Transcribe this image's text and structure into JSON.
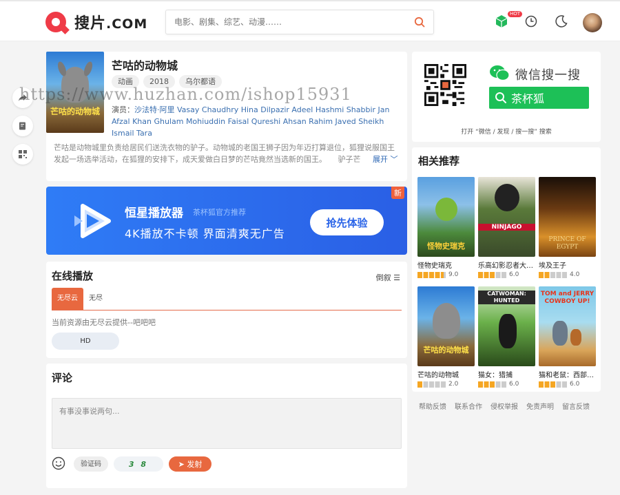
{
  "header": {
    "logo_text": "搜片",
    "logo_suffix": ".COM",
    "search_placeholder": "电影、剧集、综艺、动漫……",
    "hot_badge": "HOT",
    "icons": [
      "cube-icon",
      "history-icon",
      "moon-icon",
      "avatar"
    ]
  },
  "side_tools": [
    "share-icon",
    "edit-icon",
    "qrcode-icon"
  ],
  "movie": {
    "title": "芒咕的动物城",
    "tags": [
      "动画",
      "2018",
      "乌尔都语"
    ],
    "actors_label": "演员：",
    "actors_text": "沙法特·阿里 Vasay Chaudhry Hina Dilpazir Adeel Hashmi Shabbir Jan Afzal Khan Ghulam Mohiuddin Faisal Qureshi Ahsan Rahim Javed Sheikh Ismail Tara",
    "description": "芒咕是动物城里负责给居民们送洗衣物的驴子。动物城的老国王狮子因为年迈打算退位，狐狸说服国王发起一场选举活动，在狐狸的安排下，成天爱做白日梦的芒咕竟然当选新的国王。　　驴子芒",
    "expand_label": "展开",
    "poster_caption": "芒咕的动物城"
  },
  "watermark": "https://www.huzhan.com/ishop15931",
  "banner": {
    "title": "恒星播放器",
    "subtitle": "茶杯狐官方推荐",
    "slogan": "4K播放不卡顿  界面清爽无广告",
    "button": "抢先体验",
    "badge": "新",
    "colors": {
      "bg_start": "#2f7cf6",
      "bg_end": "#2a5fe5"
    }
  },
  "online": {
    "title": "在线播放",
    "sort_label": "倒叙",
    "sources": [
      "无尽云",
      "无尽"
    ],
    "active_source": "无尽云",
    "note": "当前资源由无尽云提供--吧吧吧",
    "episodes": [
      "HD"
    ]
  },
  "comment": {
    "title": "评论",
    "placeholder": "有事没事说两句...",
    "captcha_placeholder": "验证码",
    "captcha_image_text": "3 8",
    "send_label": "发射"
  },
  "qr": {
    "title": "微信搜一搜",
    "search_text": "茶杯狐",
    "note": "打开 “微信 / 发现 / 搜一搜” 搜索"
  },
  "recommendations": {
    "title": "相关推荐",
    "items": [
      {
        "name": "怪物史瑞克",
        "rating": "9.0",
        "score": 9.0,
        "poster_text": "怪物史瑞克"
      },
      {
        "name": "乐高幻影忍者大电影",
        "rating": "6.0",
        "score": 6.0,
        "poster_text": "NINJAGO"
      },
      {
        "name": "埃及王子",
        "rating": "4.0",
        "score": 4.0,
        "poster_text": "PRINCE OF EGYPT"
      },
      {
        "name": "芒咕的动物城",
        "rating": "2.0",
        "score": 2.0,
        "poster_text": "芒咕的动物城"
      },
      {
        "name": "猫女：猎捕",
        "rating": "6.0",
        "score": 6.0,
        "poster_text": "CATWOMAN: HUNTED"
      },
      {
        "name": "猫和老鼠：西部冒险",
        "rating": "6.0",
        "score": 6.0,
        "poster_text": "TOM and JERRY COWBOY UP!"
      }
    ]
  },
  "footer_links": [
    "帮助反馈",
    "联系合作",
    "侵权举报",
    "免责声明",
    "留言反馈"
  ]
}
